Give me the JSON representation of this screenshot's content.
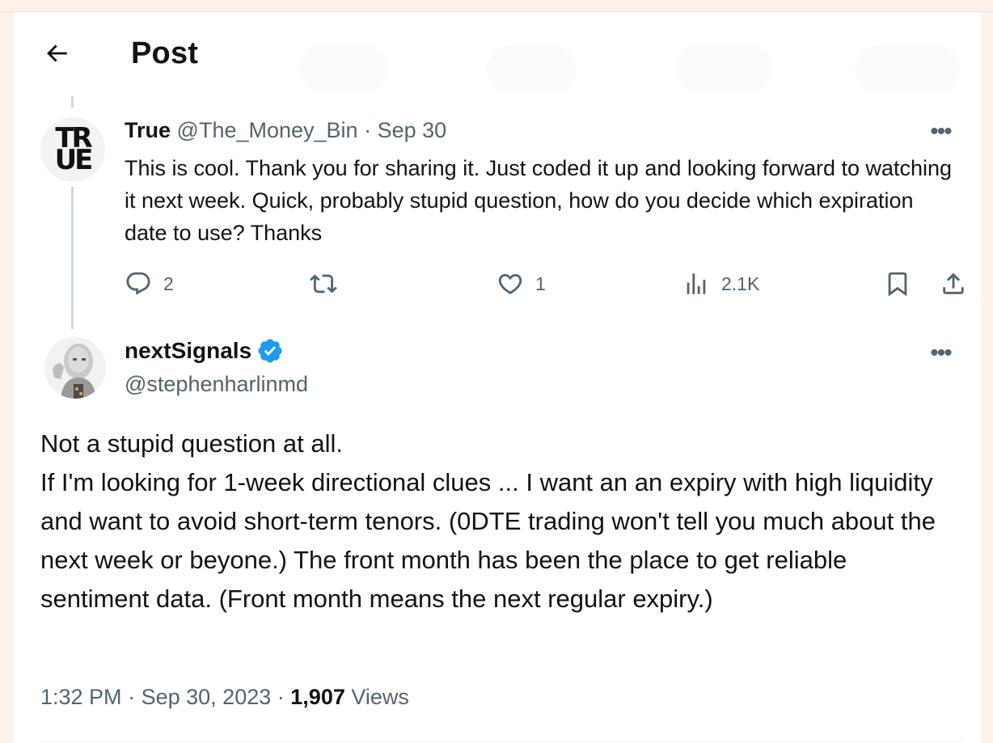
{
  "header": {
    "back_icon": "arrow-left-icon",
    "title": "Post"
  },
  "reply": {
    "avatar_text": "TRUE",
    "name": "True",
    "handle": "@The_Money_Bin",
    "separator": "·",
    "date": "Sep 30",
    "more_icon": "more-horizontal-icon",
    "more_glyph": "•••",
    "text": "This is cool.  Thank you for sharing it.  Just coded it up and looking forward to watching it next week. Quick, probably stupid question, how do you decide which expiration date to use?  Thanks",
    "actions": {
      "replies": "2",
      "reposts": "",
      "likes": "1",
      "views": "2.1K"
    }
  },
  "main": {
    "name": "nextSignals",
    "verified_icon": "verified-badge-icon",
    "verified_color": "#1d9bf0",
    "handle": "@stephenharlinmd",
    "more_glyph": "•••",
    "paragraphs": [
      "Not a stupid question at all.",
      "If I'm looking for 1-week directional clues ... I want an an expiry with high liquidity and want to avoid short-term tenors.  (0DTE trading won't tell you much about the next week or beyone.)  The front month has been the place to get reliable sentiment data.  (Front month means the next regular expiry.)"
    ],
    "time": "1:32 PM",
    "separator": "·",
    "date": "Sep 30, 2023",
    "views_count": "1,907",
    "views_label": "Views"
  },
  "colors": {
    "muted": "#536471",
    "text": "#0f1419",
    "accent": "#1d9bf0",
    "thread_line": "#cfd9de"
  }
}
